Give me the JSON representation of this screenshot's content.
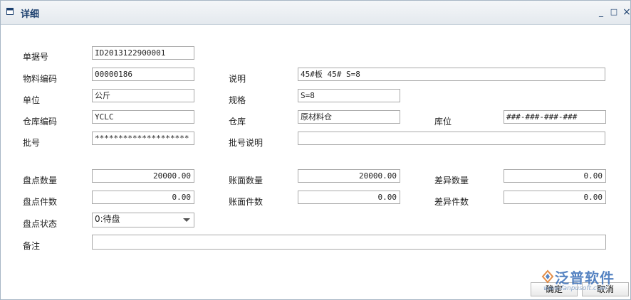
{
  "window": {
    "title": "详细",
    "minimize": "_",
    "maximize": "□",
    "close": "×"
  },
  "form": {
    "doc_no": {
      "label": "单据号",
      "value": "ID2013122900001"
    },
    "material_code": {
      "label": "物料编码",
      "value": "00000186"
    },
    "description": {
      "label": "说明",
      "value": "45#板 45# S=8"
    },
    "unit": {
      "label": "单位",
      "value": "公斤"
    },
    "spec": {
      "label": "规格",
      "value": "S=8"
    },
    "warehouse_code": {
      "label": "仓库编码",
      "value": "YCLC"
    },
    "warehouse": {
      "label": "仓库",
      "value": "原材料仓"
    },
    "location": {
      "label": "库位",
      "value": "###-###-###-###"
    },
    "batch_no": {
      "label": "批号",
      "value": "********************"
    },
    "batch_desc": {
      "label": "批号说明",
      "value": ""
    },
    "count_qty": {
      "label": "盘点数量",
      "value": "20000.00"
    },
    "book_qty": {
      "label": "账面数量",
      "value": "20000.00"
    },
    "diff_qty": {
      "label": "差异数量",
      "value": "0.00"
    },
    "count_pieces": {
      "label": "盘点件数",
      "value": "0.00"
    },
    "book_pieces": {
      "label": "账面件数",
      "value": "0.00"
    },
    "diff_pieces": {
      "label": "差异件数",
      "value": "0.00"
    },
    "count_status": {
      "label": "盘点状态",
      "value": "0:待盘"
    },
    "remarks": {
      "label": "备注",
      "value": ""
    }
  },
  "footer": {
    "confirm_label": "确定",
    "cancel_label": "取消"
  },
  "watermark": {
    "text": "泛普软件",
    "url": "www.fanpusoft.com"
  },
  "colors": {
    "title_text": "#1b3f6e",
    "border": "#a9a9a9",
    "watermark": "#3a6fb8"
  }
}
